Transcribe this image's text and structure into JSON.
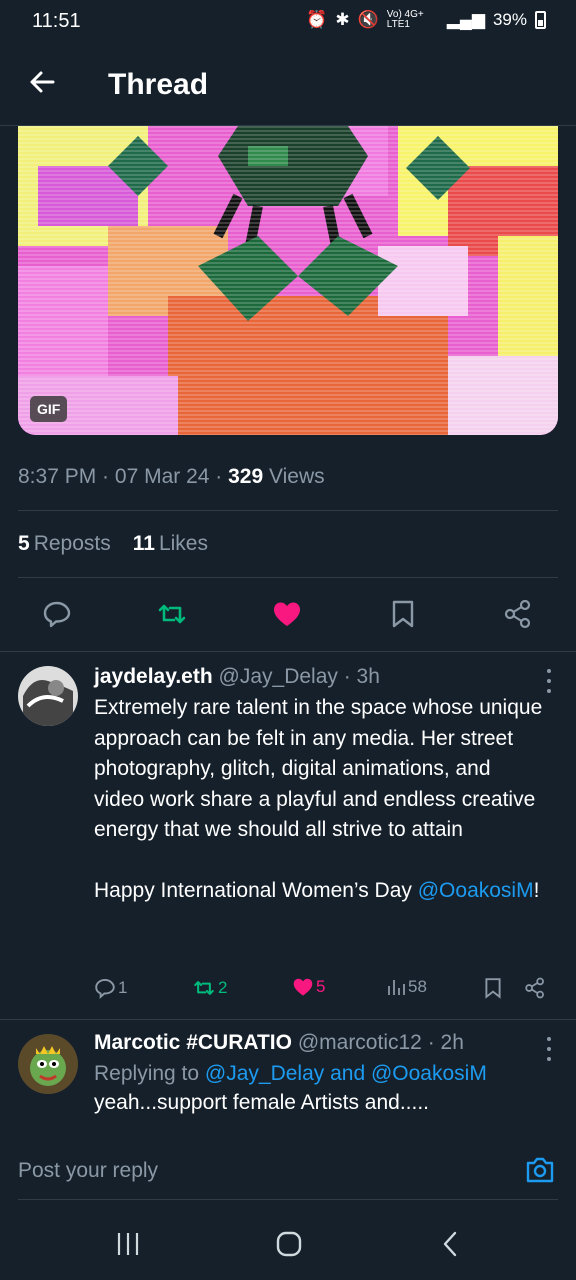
{
  "status": {
    "time": "11:51",
    "network": "Vo) 4G+ LTE1",
    "battery": "39%"
  },
  "header": {
    "title": "Thread"
  },
  "media": {
    "badge": "GIF"
  },
  "tweet": {
    "time": "8:37 PM",
    "sep1": " · ",
    "date": "07 Mar 24",
    "sep2": " · ",
    "views_count": "329",
    "views_label": " Views",
    "reposts_count": "5",
    "reposts_label": "Reposts",
    "likes_count": "11",
    "likes_label": "Likes"
  },
  "replies": [
    {
      "name": "jaydelay.eth",
      "handle": "@Jay_Delay",
      "time": " · 3h",
      "text": "Extremely rare talent in the space whose unique approach can be felt in any media. Her street photography, glitch, digital animations, and video work share a playful and endless creative energy that we should all strive to attain",
      "text2_prefix": "Happy International Women’s Day ",
      "text2_mention": "@OoakosiM",
      "text2_suffix": "!",
      "replies": "1",
      "reposts": "2",
      "likes": "5",
      "views": "58"
    },
    {
      "name": "Marcotic #CURATIO",
      "handle": "@marcotic12",
      "time": " · 2h",
      "replying_prefix": "Replying to ",
      "replying_to": "@Jay_Delay and @OoakosiM",
      "text": "yeah...support female Artists  and....."
    }
  ],
  "composer": {
    "placeholder": "Post your reply"
  },
  "colors": {
    "background": "#15202b",
    "accent": "#1d9bf0",
    "repost": "#00ba7c",
    "like": "#f91880"
  }
}
